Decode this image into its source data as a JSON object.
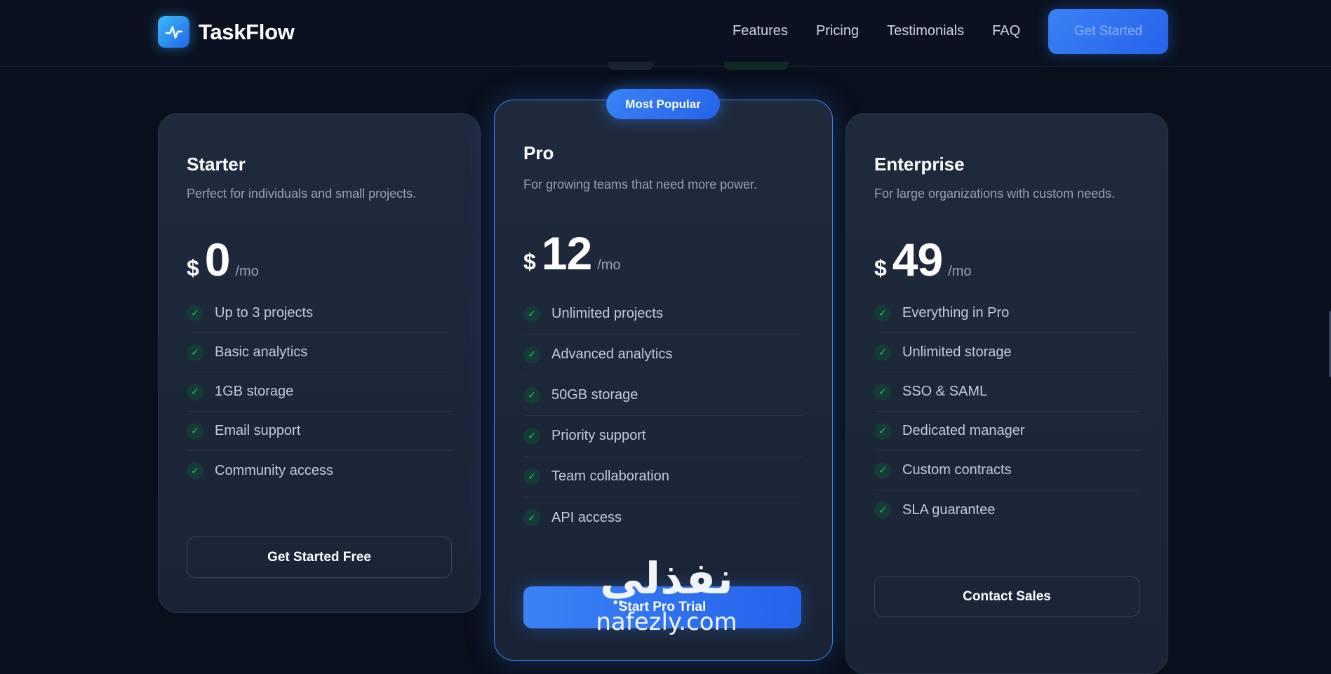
{
  "nav": {
    "brand": "TaskFlow",
    "links": [
      "Features",
      "Pricing",
      "Testimonials",
      "FAQ"
    ],
    "cta": "Get Started"
  },
  "badge": "Most Popular",
  "plans": [
    {
      "name": "Starter",
      "description": "Perfect for individuals and small projects.",
      "currency": "$",
      "price": "0",
      "period": "/mo",
      "features": [
        "Up to 3 projects",
        "Basic analytics",
        "1GB storage",
        "Email support",
        "Community access"
      ],
      "cta": "Get Started Free"
    },
    {
      "name": "Pro",
      "description": "For growing teams that need more power.",
      "currency": "$",
      "price": "12",
      "period": "/mo",
      "features": [
        "Unlimited projects",
        "Advanced analytics",
        "50GB storage",
        "Priority support",
        "Team collaboration",
        "API access"
      ],
      "cta": "Start Pro Trial"
    },
    {
      "name": "Enterprise",
      "description": "For large organizations with custom needs.",
      "currency": "$",
      "price": "49",
      "period": "/mo",
      "features": [
        "Everything in Pro",
        "Unlimited storage",
        "SSO & SAML",
        "Dedicated manager",
        "Custom contracts",
        "SLA guarantee"
      ],
      "cta": "Contact Sales"
    }
  ],
  "icons": {
    "logo": "pulse-icon",
    "feature_bullet": "check-icon"
  },
  "watermark": {
    "arabic": "نفذلي",
    "latin": "nafezly.com"
  },
  "colors": {
    "background": "#0a0f1c",
    "card": "#1f2a3d",
    "accent": "#3b82f6",
    "check": "#22c55e"
  }
}
